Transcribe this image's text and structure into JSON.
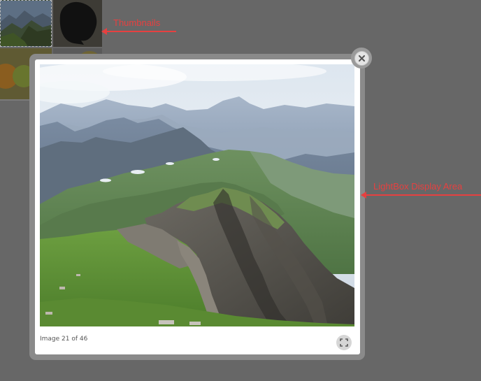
{
  "thumbnails": {
    "label": "Thumbnails",
    "items": [
      {
        "icon": "mountain-landscape-thumbnail"
      },
      {
        "icon": "dark-object-thumbnail"
      },
      {
        "icon": "fruit-thumbnail"
      },
      {
        "icon": "blank-thumbnail"
      }
    ]
  },
  "annotations": {
    "thumbnails": "Thumbnails",
    "display_area": "LightBox Display Area",
    "color": "#e64040"
  },
  "lightbox": {
    "image_icon": "mountain-landscape-image",
    "caption": "Image 21 of 46",
    "fullscreen_icon": "fullscreen-icon",
    "close_icon": "close-icon"
  },
  "colors": {
    "overlay": "#676767",
    "panel": "#ffffff",
    "frame": "#8a8a8a"
  }
}
